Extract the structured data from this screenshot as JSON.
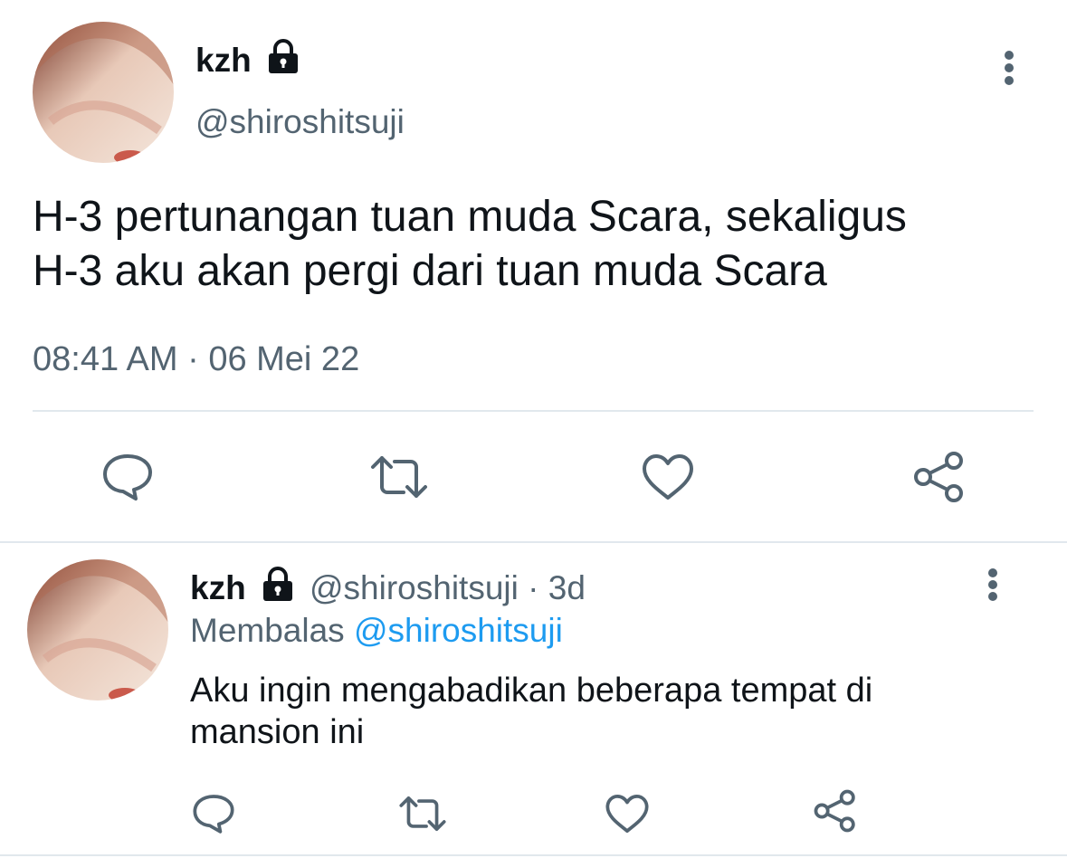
{
  "main_tweet": {
    "author_name": "kzh",
    "author_handle": "@shiroshitsuji",
    "text_line1": "H-3 pertunangan tuan muda Scara, sekaligus",
    "text_line2": "H-3 aku akan pergi dari tuan muda Scara",
    "timestamp": "08:41 AM · 06 Mei 22",
    "actions": [
      "reply-icon",
      "retweet-icon",
      "like-icon",
      "share-icon"
    ]
  },
  "reply_tweet": {
    "author_name": "kzh",
    "author_handle": "@shiroshitsuji",
    "age": "· 3d",
    "replying_prefix": "Membalas",
    "replying_to": "@shiroshitsuji",
    "text_line1": "Aku ingin mengabadikan beberapa tempat di",
    "text_line2": "mansion ini",
    "actions": [
      "reply-icon",
      "retweet-icon",
      "like-icon",
      "share-icon"
    ]
  },
  "colors": {
    "text": "#0f1419",
    "secondary": "#536471",
    "link": "#1d9bf0",
    "divider": "#e1e8ed"
  }
}
